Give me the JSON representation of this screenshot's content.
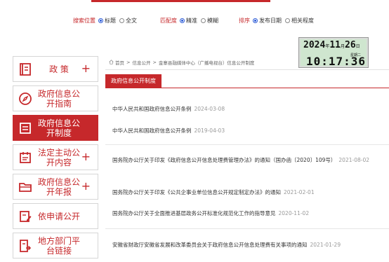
{
  "search_options": {
    "position": {
      "label": "搜索位置",
      "options": [
        {
          "label": "标题",
          "selected": true
        },
        {
          "label": "全文",
          "selected": false
        }
      ]
    },
    "match": {
      "label": "匹配度",
      "options": [
        {
          "label": "精准",
          "selected": true
        },
        {
          "label": "模糊",
          "selected": false
        }
      ]
    },
    "sort": {
      "label": "排序",
      "options": [
        {
          "label": "发布日期",
          "selected": true
        },
        {
          "label": "相关程度",
          "selected": false
        }
      ]
    }
  },
  "clock": {
    "year": "2024",
    "year_unit": "年",
    "month": "11",
    "month_unit": "月",
    "day": "26",
    "day_unit": "日",
    "weekday": "星期二",
    "time": "10:17:36"
  },
  "sidebar": {
    "items": [
      {
        "label": "政 策",
        "plus": "+",
        "icon": "policy-book-icon"
      },
      {
        "label": "政府信息公开指南",
        "plus": "",
        "icon": "compass-icon"
      },
      {
        "label": "政府信息公开制度",
        "plus": "",
        "icon": "document-list-icon"
      },
      {
        "label": "法定主动公开内容",
        "plus": "+",
        "icon": "calendar-list-icon"
      },
      {
        "label": "政府信息公开年报",
        "plus": "+",
        "icon": "folder-icon"
      },
      {
        "label": "依申请公开",
        "plus": "",
        "icon": "edit-form-icon"
      },
      {
        "label": "地方部门平台链接",
        "plus": "",
        "icon": "link-document-icon"
      }
    ]
  },
  "breadcrumb": {
    "items": [
      "首页",
      "信息公开",
      "金寨县融媒体中心（广播电视台）信息公开制度"
    ],
    "separator": ">"
  },
  "tab": {
    "label": "政府信息公开制度"
  },
  "documents": [
    {
      "title": "中华人民共和国政府信息公开条例",
      "date": "2024-03-08"
    },
    {
      "title": "中华人民共和国政府信息公开条例",
      "date": "2019-04-03"
    },
    {
      "title": "国务院办公厅关于印发《政府信息公开信息处理费管理办法》的通知（国办函〔2020〕109号）",
      "date": "2021-08-02"
    },
    {
      "title": "国务院办公厅关于印发《公共企事业单位信息公开规定制定办法》的通知",
      "date": "2021-02-01"
    },
    {
      "title": "国务院办公厅关于全面推进基层政务公开标准化规范化工作的指导意见",
      "date": "2020-11-02"
    },
    {
      "title": "安徽省财政厅安徽省发展和改革委员会关于政府信息公开信息处理费有关事项的通知",
      "date": "2021-01-29"
    }
  ],
  "colors": {
    "accent": "#c6282b",
    "radio": "#2a5ad6"
  }
}
